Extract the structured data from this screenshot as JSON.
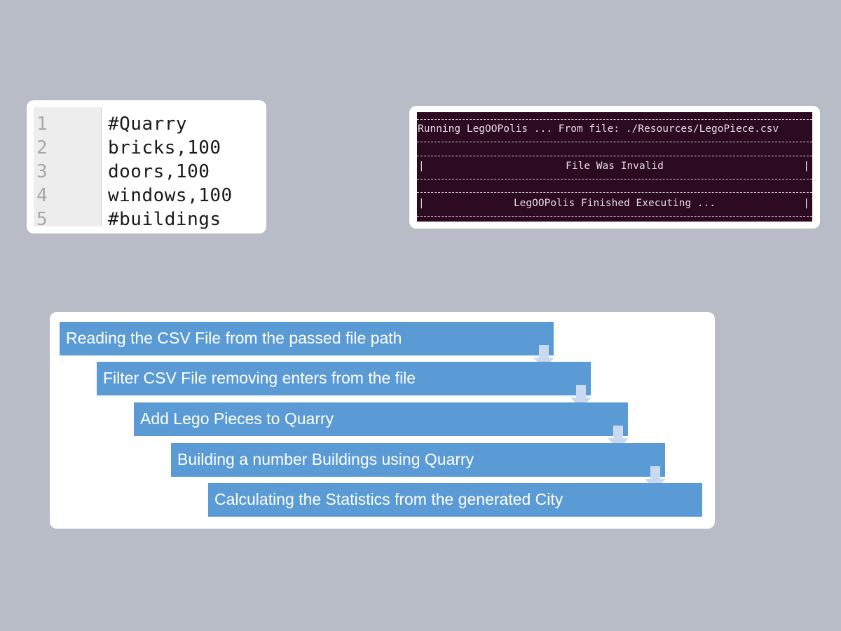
{
  "code_editor": {
    "lines": [
      {
        "num": "1",
        "text": "#Quarry"
      },
      {
        "num": "2",
        "text": "bricks,100"
      },
      {
        "num": "3",
        "text": "doors,100"
      },
      {
        "num": "4",
        "text": "windows,100"
      },
      {
        "num": "5",
        "text": "#buildings"
      }
    ]
  },
  "terminal": {
    "background": "#2b0a22",
    "running_line": "Running LegOOPolis ... From file: ./Resources/LegoPiece.csv",
    "invalid_line": "File Was Invalid",
    "finished_line": "LegOOPolis Finished Executing ...",
    "border_char": "|"
  },
  "flow": {
    "step_color": "#5b9bd5",
    "arrow_color": "#c9daf0",
    "steps": [
      {
        "label": "Reading the CSV File from the passed file path"
      },
      {
        "label": "Filter CSV File removing enters from the file"
      },
      {
        "label": "Add Lego Pieces to Quarry"
      },
      {
        "label": "Building a number Buildings using Quarry"
      },
      {
        "label": "Calculating the Statistics from the generated City"
      }
    ]
  }
}
